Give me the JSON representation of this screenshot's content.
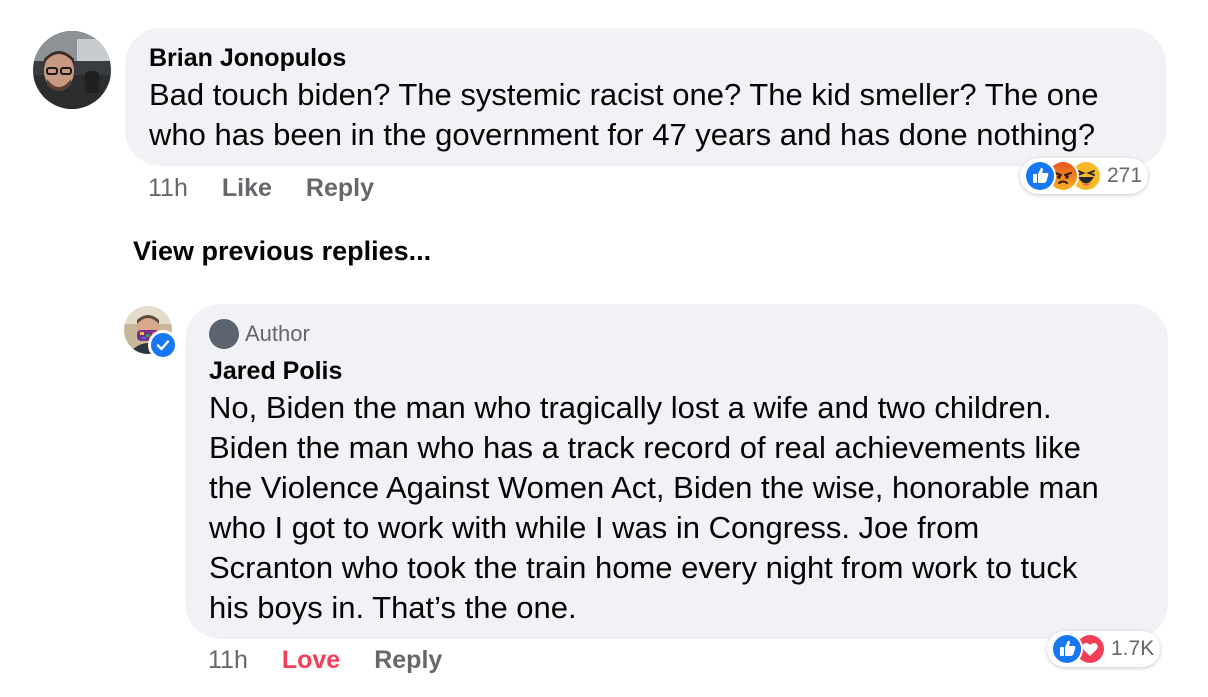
{
  "comment": {
    "author": "Brian Jonopulos",
    "text_lines": [
      "Bad touch biden? The systemic racist one? The kid smeller? The one",
      "who has been in the government for 47 years and has done nothing?"
    ],
    "time": "11h",
    "like_label": "Like",
    "reply_label": "Reply",
    "reactions": [
      "like-icon",
      "angry-icon",
      "haha-icon"
    ],
    "reaction_count": "271"
  },
  "view_previous_label": "View previous replies...",
  "reply": {
    "badge": "Author",
    "author": "Jared Polis",
    "text_lines": [
      "No, Biden the man who tragically lost a wife and two children.",
      "Biden the man who has a track record of real achievements like",
      "the Violence Against Women Act, Biden the wise, honorable man",
      "who I got to work with while I was in Congress.  Joe from",
      "Scranton who took the train home every night from work to tuck",
      "his boys in. That’s the one."
    ],
    "time": "11h",
    "love_label": "Love",
    "reply_label": "Reply",
    "reactions": [
      "like-icon",
      "love-icon"
    ],
    "reaction_count": "1.7K"
  },
  "colors": {
    "bubble": "#f0f2f5",
    "meta_text": "#65676b",
    "love": "#f33e58",
    "like_blue": "#1877f2"
  }
}
